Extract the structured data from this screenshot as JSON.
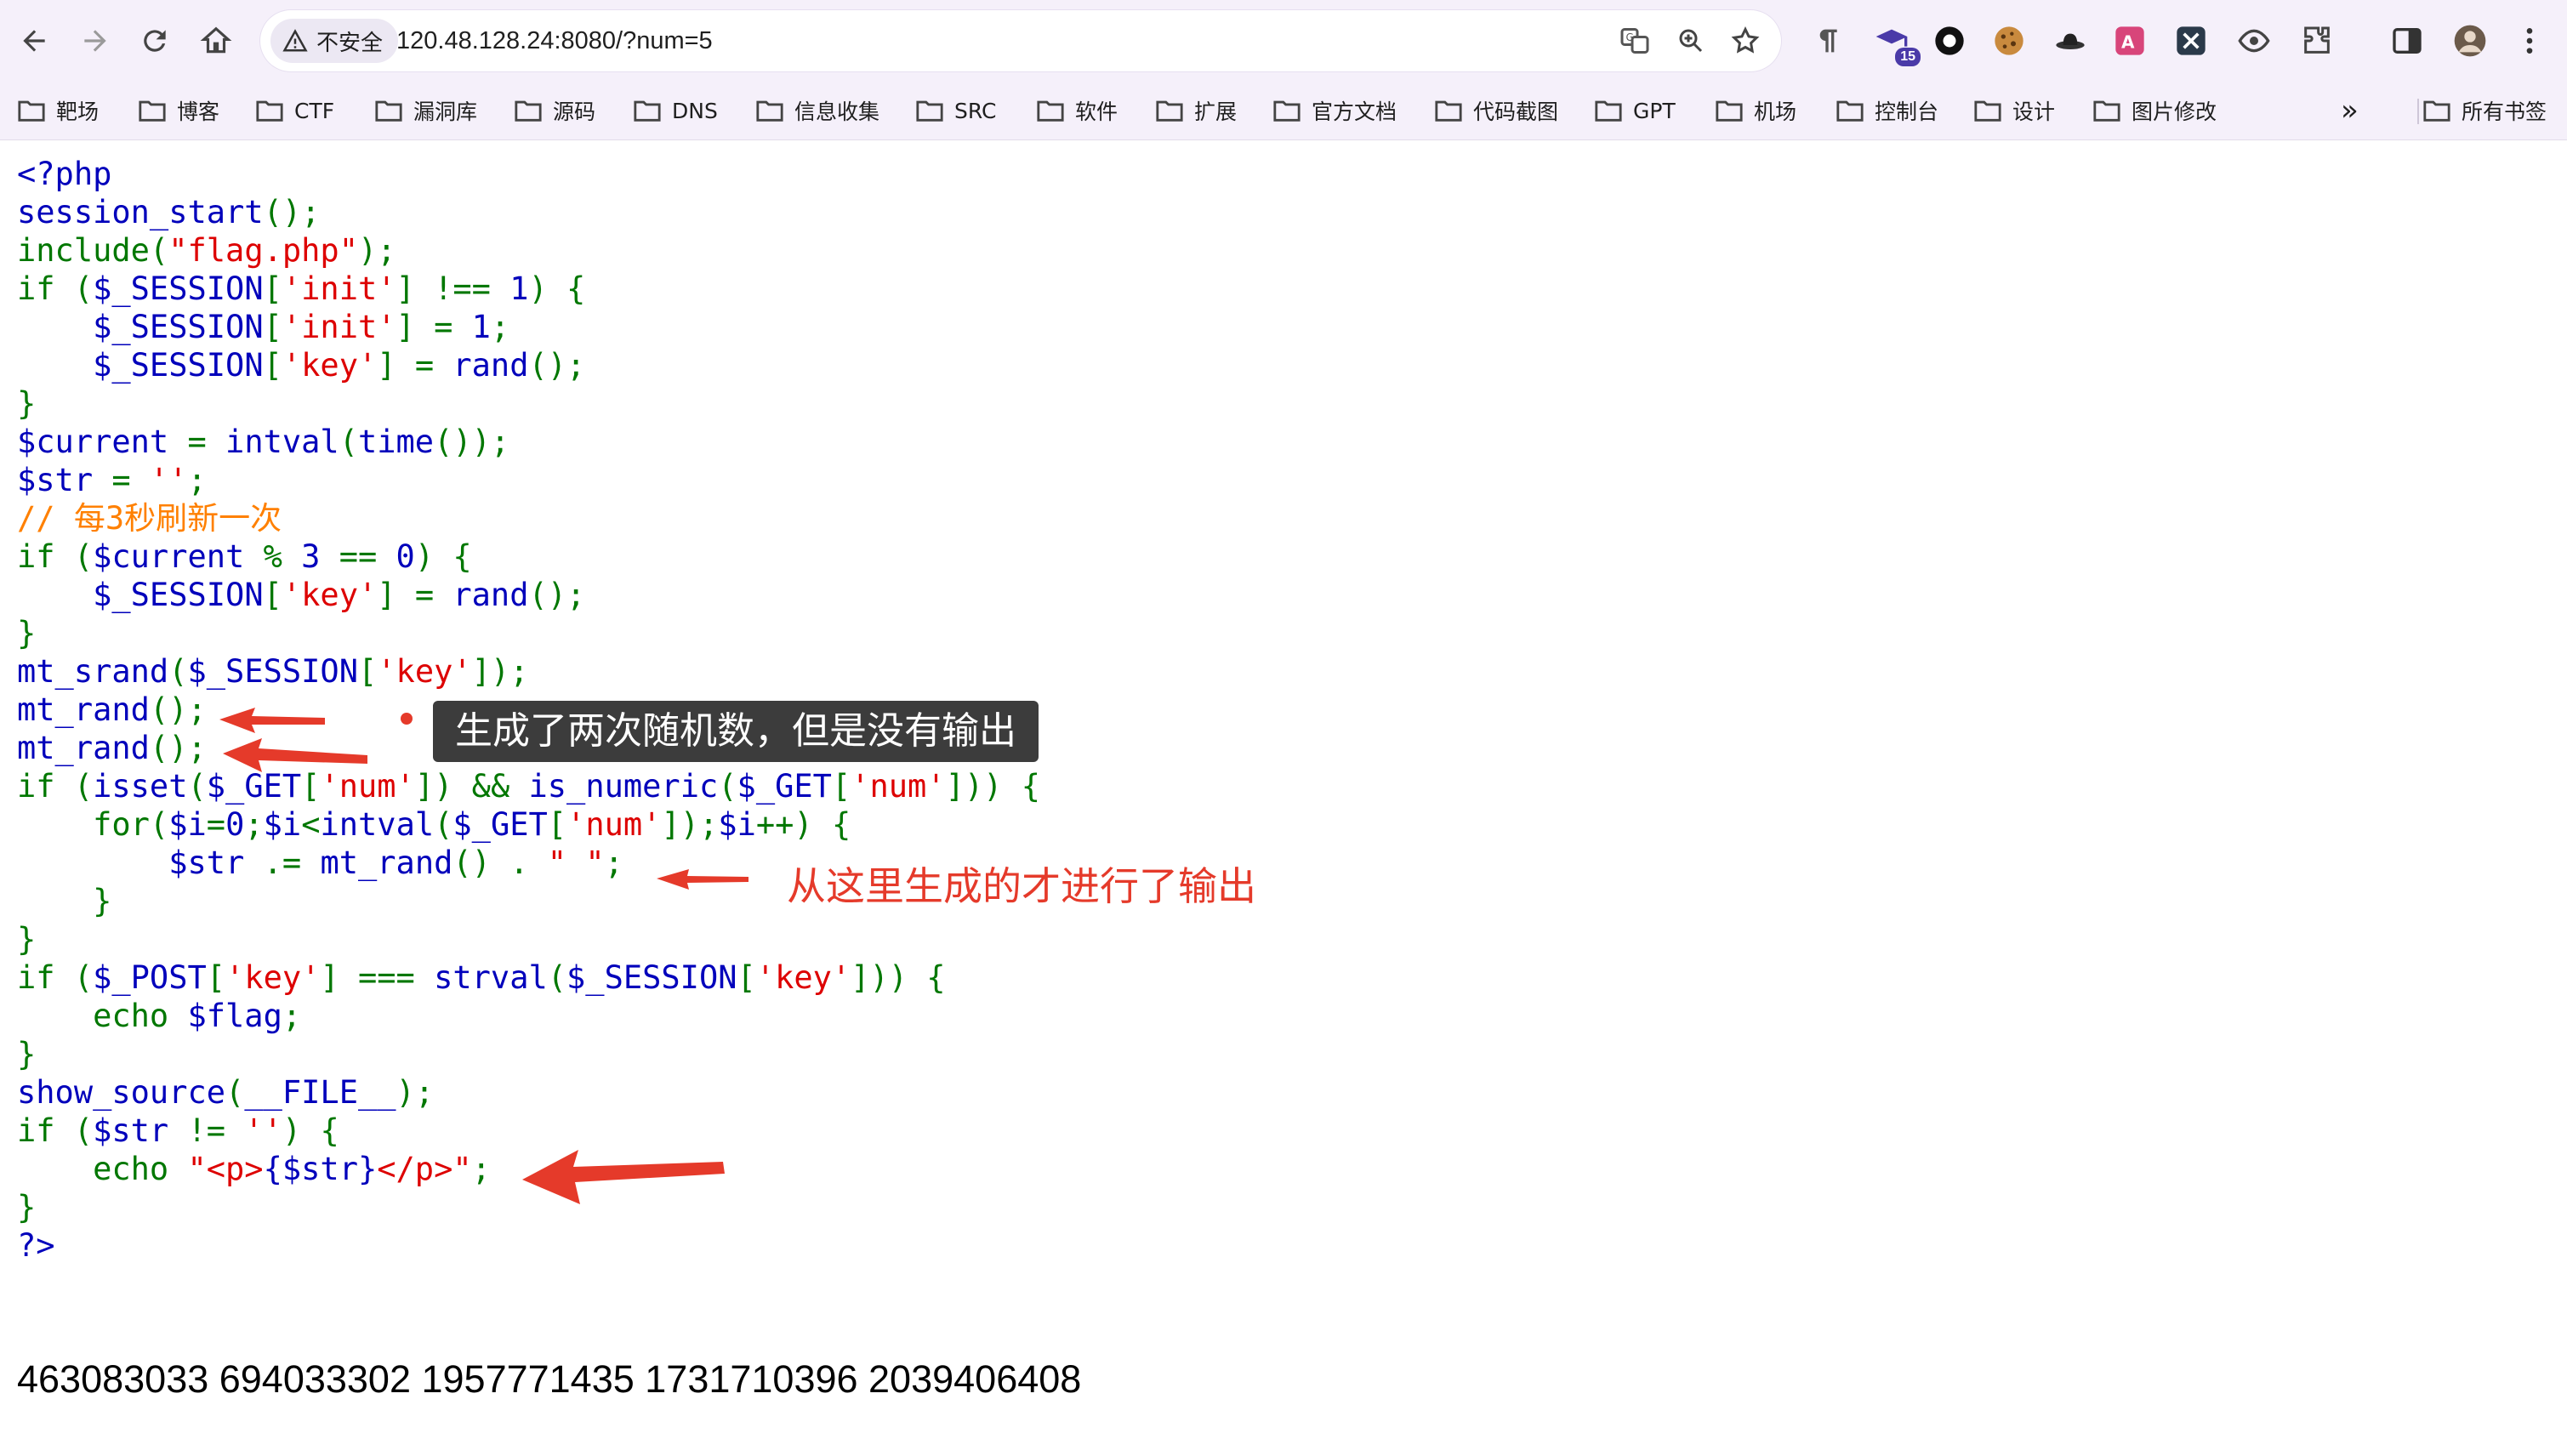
{
  "browser": {
    "security_label": "不安全",
    "url": "120.48.128.24:8080/?num=5",
    "extension_badge": "15"
  },
  "bookmarks": {
    "items": [
      {
        "label": "靶场"
      },
      {
        "label": "博客"
      },
      {
        "label": "CTF"
      },
      {
        "label": "漏洞库"
      },
      {
        "label": "源码"
      },
      {
        "label": "DNS"
      },
      {
        "label": "信息收集"
      },
      {
        "label": "SRC"
      },
      {
        "label": "软件"
      },
      {
        "label": "扩展"
      },
      {
        "label": "官方文档"
      },
      {
        "label": "代码截图"
      },
      {
        "label": "GPT"
      },
      {
        "label": "机场"
      },
      {
        "label": "控制台"
      },
      {
        "label": "设计"
      },
      {
        "label": "图片修改"
      }
    ],
    "overflow": "»",
    "all_bookmarks": "所有书签"
  },
  "source": {
    "lines": [
      [
        {
          "t": "<?php",
          "c": "v"
        }
      ],
      [
        {
          "t": "session_start",
          "c": "v"
        },
        {
          "t": "();",
          "c": "k"
        }
      ],
      [
        {
          "t": "include(",
          "c": "k"
        },
        {
          "t": "\"flag.php\"",
          "c": "s"
        },
        {
          "t": ");",
          "c": "k"
        }
      ],
      [
        {
          "t": "if (",
          "c": "k"
        },
        {
          "t": "$_SESSION",
          "c": "v"
        },
        {
          "t": "[",
          "c": "k"
        },
        {
          "t": "'init'",
          "c": "s"
        },
        {
          "t": "] !== ",
          "c": "k"
        },
        {
          "t": "1",
          "c": "v"
        },
        {
          "t": ") {",
          "c": "k"
        }
      ],
      [
        {
          "t": "    ",
          "c": "k"
        },
        {
          "t": "$_SESSION",
          "c": "v"
        },
        {
          "t": "[",
          "c": "k"
        },
        {
          "t": "'init'",
          "c": "s"
        },
        {
          "t": "] = ",
          "c": "k"
        },
        {
          "t": "1",
          "c": "v"
        },
        {
          "t": ";",
          "c": "k"
        }
      ],
      [
        {
          "t": "    ",
          "c": "k"
        },
        {
          "t": "$_SESSION",
          "c": "v"
        },
        {
          "t": "[",
          "c": "k"
        },
        {
          "t": "'key'",
          "c": "s"
        },
        {
          "t": "] = ",
          "c": "k"
        },
        {
          "t": "rand",
          "c": "v"
        },
        {
          "t": "();",
          "c": "k"
        }
      ],
      [
        {
          "t": "}",
          "c": "k"
        }
      ],
      [
        {
          "t": "$current ",
          "c": "v"
        },
        {
          "t": "= ",
          "c": "k"
        },
        {
          "t": "intval",
          "c": "v"
        },
        {
          "t": "(",
          "c": "k"
        },
        {
          "t": "time",
          "c": "v"
        },
        {
          "t": "());",
          "c": "k"
        }
      ],
      [
        {
          "t": "$str ",
          "c": "v"
        },
        {
          "t": "= ",
          "c": "k"
        },
        {
          "t": "''",
          "c": "s"
        },
        {
          "t": ";",
          "c": "k"
        }
      ],
      [
        {
          "t": "// 每3秒刷新一次",
          "c": "c"
        }
      ],
      [
        {
          "t": "if (",
          "c": "k"
        },
        {
          "t": "$current ",
          "c": "v"
        },
        {
          "t": "% ",
          "c": "k"
        },
        {
          "t": "3 ",
          "c": "v"
        },
        {
          "t": "== ",
          "c": "k"
        },
        {
          "t": "0",
          "c": "v"
        },
        {
          "t": ") {",
          "c": "k"
        }
      ],
      [
        {
          "t": "    ",
          "c": "k"
        },
        {
          "t": "$_SESSION",
          "c": "v"
        },
        {
          "t": "[",
          "c": "k"
        },
        {
          "t": "'key'",
          "c": "s"
        },
        {
          "t": "] = ",
          "c": "k"
        },
        {
          "t": "rand",
          "c": "v"
        },
        {
          "t": "();",
          "c": "k"
        }
      ],
      [
        {
          "t": "}",
          "c": "k"
        }
      ],
      [
        {
          "t": "mt_srand",
          "c": "v"
        },
        {
          "t": "(",
          "c": "k"
        },
        {
          "t": "$_SESSION",
          "c": "v"
        },
        {
          "t": "[",
          "c": "k"
        },
        {
          "t": "'key'",
          "c": "s"
        },
        {
          "t": "]);",
          "c": "k"
        }
      ],
      [
        {
          "t": "mt_rand",
          "c": "v"
        },
        {
          "t": "();",
          "c": "k"
        }
      ],
      [
        {
          "t": "mt_rand",
          "c": "v"
        },
        {
          "t": "();",
          "c": "k"
        }
      ],
      [
        {
          "t": "if (",
          "c": "k"
        },
        {
          "t": "isset",
          "c": "v"
        },
        {
          "t": "(",
          "c": "k"
        },
        {
          "t": "$_GET",
          "c": "v"
        },
        {
          "t": "[",
          "c": "k"
        },
        {
          "t": "'num'",
          "c": "s"
        },
        {
          "t": "]) && ",
          "c": "k"
        },
        {
          "t": "is_numeric",
          "c": "v"
        },
        {
          "t": "(",
          "c": "k"
        },
        {
          "t": "$_GET",
          "c": "v"
        },
        {
          "t": "[",
          "c": "k"
        },
        {
          "t": "'num'",
          "c": "s"
        },
        {
          "t": "])) {",
          "c": "k"
        }
      ],
      [
        {
          "t": "    for(",
          "c": "k"
        },
        {
          "t": "$i",
          "c": "v"
        },
        {
          "t": "=",
          "c": "k"
        },
        {
          "t": "0",
          "c": "v"
        },
        {
          "t": ";",
          "c": "k"
        },
        {
          "t": "$i",
          "c": "v"
        },
        {
          "t": "<",
          "c": "k"
        },
        {
          "t": "intval",
          "c": "v"
        },
        {
          "t": "(",
          "c": "k"
        },
        {
          "t": "$_GET",
          "c": "v"
        },
        {
          "t": "[",
          "c": "k"
        },
        {
          "t": "'num'",
          "c": "s"
        },
        {
          "t": "]);",
          "c": "k"
        },
        {
          "t": "$i",
          "c": "v"
        },
        {
          "t": "++) {",
          "c": "k"
        }
      ],
      [
        {
          "t": "        ",
          "c": "k"
        },
        {
          "t": "$str ",
          "c": "v"
        },
        {
          "t": ".= ",
          "c": "k"
        },
        {
          "t": "mt_rand",
          "c": "v"
        },
        {
          "t": "() . ",
          "c": "k"
        },
        {
          "t": "\" \"",
          "c": "s"
        },
        {
          "t": ";",
          "c": "k"
        }
      ],
      [
        {
          "t": "    }",
          "c": "k"
        }
      ],
      [
        {
          "t": "}",
          "c": "k"
        }
      ],
      [
        {
          "t": "if (",
          "c": "k"
        },
        {
          "t": "$_POST",
          "c": "v"
        },
        {
          "t": "[",
          "c": "k"
        },
        {
          "t": "'key'",
          "c": "s"
        },
        {
          "t": "] === ",
          "c": "k"
        },
        {
          "t": "strval",
          "c": "v"
        },
        {
          "t": "(",
          "c": "k"
        },
        {
          "t": "$_SESSION",
          "c": "v"
        },
        {
          "t": "[",
          "c": "k"
        },
        {
          "t": "'key'",
          "c": "s"
        },
        {
          "t": "])) {",
          "c": "k"
        }
      ],
      [
        {
          "t": "    echo ",
          "c": "k"
        },
        {
          "t": "$flag",
          "c": "v"
        },
        {
          "t": ";",
          "c": "k"
        }
      ],
      [
        {
          "t": "}",
          "c": "k"
        }
      ],
      [
        {
          "t": "show_source",
          "c": "v"
        },
        {
          "t": "(",
          "c": "k"
        },
        {
          "t": "__FILE__",
          "c": "v"
        },
        {
          "t": ");",
          "c": "k"
        }
      ],
      [
        {
          "t": "if (",
          "c": "k"
        },
        {
          "t": "$str ",
          "c": "v"
        },
        {
          "t": "!= ",
          "c": "k"
        },
        {
          "t": "''",
          "c": "s"
        },
        {
          "t": ") {",
          "c": "k"
        }
      ],
      [
        {
          "t": "    echo ",
          "c": "k"
        },
        {
          "t": "\"<p>",
          "c": "s"
        },
        {
          "t": "{$str}",
          "c": "v"
        },
        {
          "t": "</p>\"",
          "c": "s"
        },
        {
          "t": ";",
          "c": "k"
        }
      ],
      [
        {
          "t": "}",
          "c": "k"
        }
      ],
      [
        {
          "t": "?>",
          "c": "v"
        }
      ]
    ],
    "output": "463083033 694033302 1957771435 1731710396 2039406408"
  },
  "annotations": {
    "tooltip": "生成了两次随机数，但是没有输出",
    "note": "从这里生成的才进行了输出"
  },
  "colors": {
    "keyword": "#007700",
    "string": "#dd0000",
    "default": "#0000bb",
    "comment": "#ff8000",
    "annotation_red": "#e53a2a"
  }
}
